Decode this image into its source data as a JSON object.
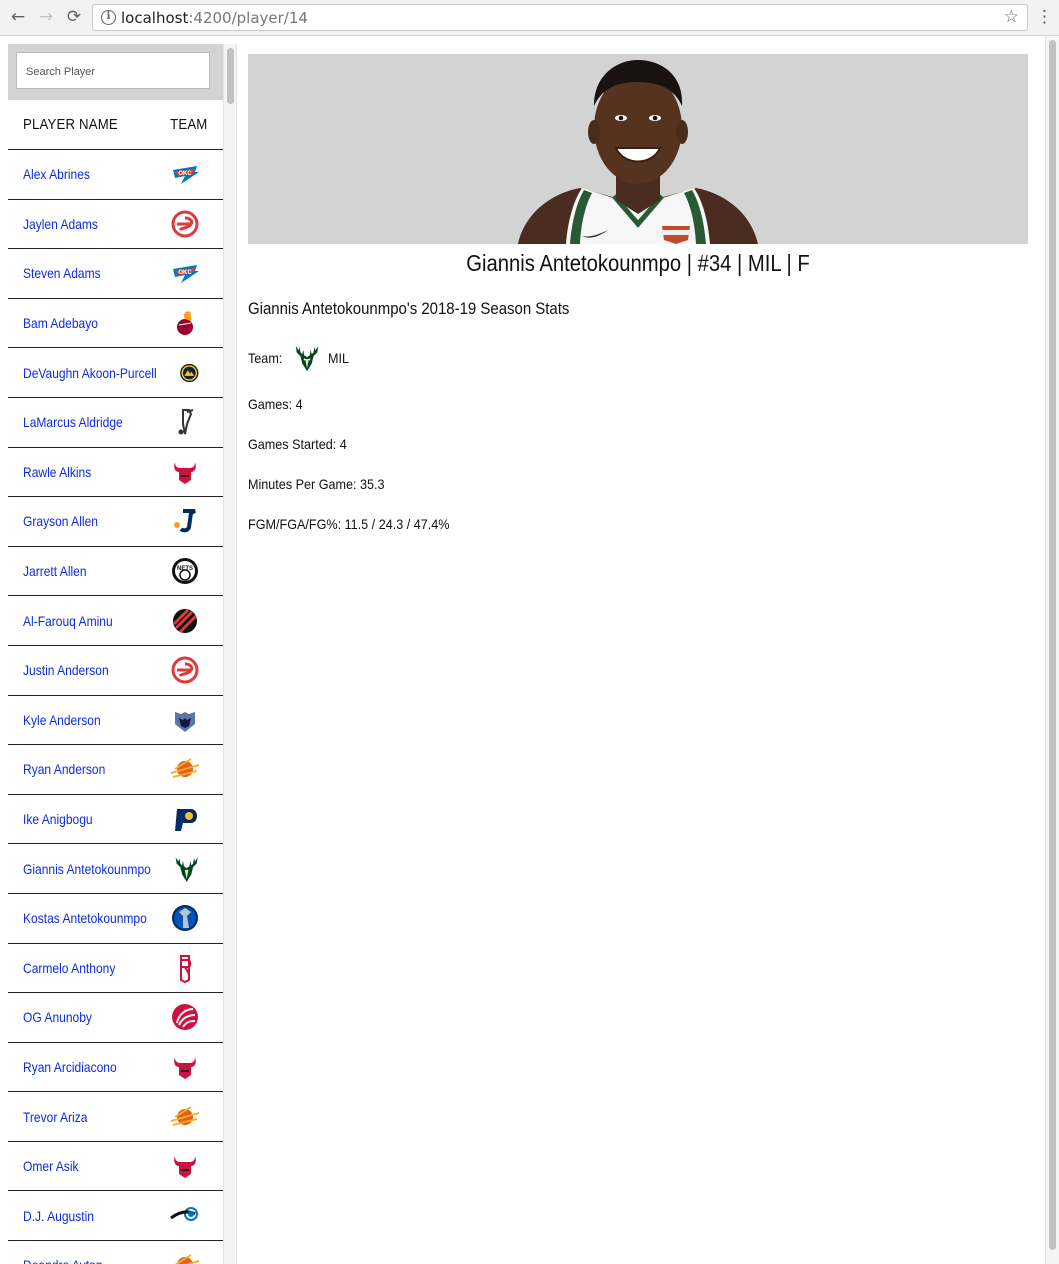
{
  "browser": {
    "url_host": "localhost",
    "url_path": ":4200/player/14",
    "back_icon": "←",
    "forward_icon": "→",
    "reload_icon": "⟳",
    "info_icon": "i",
    "star_icon": "☆",
    "menu_icon": "⋮"
  },
  "sidebar": {
    "search_placeholder": "Search Player",
    "header_name": "PLAYER NAME",
    "header_team": "TEAM",
    "players": [
      {
        "name": "Alex Abrines",
        "team": "OKC"
      },
      {
        "name": "Jaylen Adams",
        "team": "ATL"
      },
      {
        "name": "Steven Adams",
        "team": "OKC"
      },
      {
        "name": "Bam Adebayo",
        "team": "MIA"
      },
      {
        "name": "DeVaughn Akoon-Purcell",
        "team": "DEN"
      },
      {
        "name": "LaMarcus Aldridge",
        "team": "SAS"
      },
      {
        "name": "Rawle Alkins",
        "team": "CHI"
      },
      {
        "name": "Grayson Allen",
        "team": "UTA"
      },
      {
        "name": "Jarrett Allen",
        "team": "BKN"
      },
      {
        "name": "Al-Farouq Aminu",
        "team": "POR"
      },
      {
        "name": "Justin Anderson",
        "team": "ATL"
      },
      {
        "name": "Kyle Anderson",
        "team": "MEM"
      },
      {
        "name": "Ryan Anderson",
        "team": "PHX"
      },
      {
        "name": "Ike Anigbogu",
        "team": "IND"
      },
      {
        "name": "Giannis Antetokounmpo",
        "team": "MIL"
      },
      {
        "name": "Kostas Antetokounmpo",
        "team": "DAL"
      },
      {
        "name": "Carmelo Anthony",
        "team": "HOU"
      },
      {
        "name": "OG Anunoby",
        "team": "TOR"
      },
      {
        "name": "Ryan Arcidiacono",
        "team": "CHI"
      },
      {
        "name": "Trevor Ariza",
        "team": "PHX"
      },
      {
        "name": "Omer Asik",
        "team": "CHI"
      },
      {
        "name": "D.J. Augustin",
        "team": "ORL"
      },
      {
        "name": "Deandre Ayton",
        "team": "PHX"
      }
    ]
  },
  "player": {
    "title": "Giannis Antetokounmpo  |  #34  |  MIL  |  F",
    "stats_heading": "Giannis Antetokounmpo's 2018-19 Season Stats",
    "team_label": "Team:",
    "team_abbr": "MIL",
    "games": "Games: 4",
    "games_started": "Games Started: 4",
    "minutes": "Minutes Per Game: 35.3",
    "shooting": "FGM/FGA/FG%: 11.5 / 24.3 / 47.4%"
  },
  "colors": {
    "link": "#0f2ce0",
    "hero_bg": "#d3d3d3",
    "OKC": "#007ac1",
    "ATL": "#e03a3e",
    "MIA": "#98002e",
    "DEN": "#0e2240",
    "SAS": "#333333",
    "CHI": "#ce1141",
    "UTA": "#002b5c",
    "BKN": "#111111",
    "POR": "#e03a3e",
    "MEM": "#5d76a9",
    "PHX": "#e56020",
    "IND": "#002d62",
    "MIL": "#00471b",
    "DAL": "#0053bc",
    "HOU": "#ce1141",
    "TOR": "#ce1141",
    "ORL": "#0077c0"
  }
}
